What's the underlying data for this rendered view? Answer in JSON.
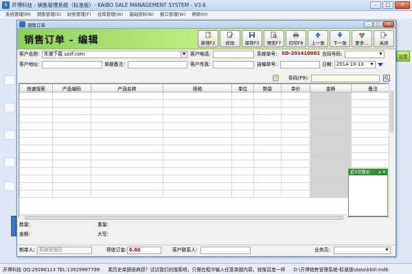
{
  "app": {
    "title": "开博科技 - 销售管理系统（标准版）- KAIBO SALE MANAGEMENT SYSTEM - V3.6",
    "menu": [
      "系统管理(M)",
      "销售管理(S)",
      "财务管理(F)",
      "仓库管理(W)",
      "基础资料(B)",
      "窗口管理(W)",
      "帮助(H)"
    ],
    "right_button": "设置"
  },
  "status_bar": {
    "company": "开博科技 QQ:29286113 TEL:13929987799",
    "hint": "素历史单据很麻烦？试试我们的搜索吧，只需在框中输入任意单据内容，就像百度一样",
    "path": "D:\\开博销售管理系统-标准版\\data\\kbill.mdb"
  },
  "window": {
    "title": "销售订单",
    "page_title": "销售订单 - 编辑"
  },
  "toolbar": [
    {
      "label": "新增F2",
      "icon": "new-icon"
    },
    {
      "label": "修改",
      "icon": "edit-icon"
    },
    {
      "label": "保存F3",
      "icon": "save-icon"
    },
    {
      "label": "预览F7",
      "icon": "preview-icon"
    },
    {
      "label": "打印F8",
      "icon": "print-icon"
    },
    {
      "label": "上一张",
      "icon": "arrow-up-icon"
    },
    {
      "label": "下一张",
      "icon": "arrow-down-icon"
    },
    {
      "label": "更多…",
      "icon": "more-icon"
    },
    {
      "label": "关闭",
      "icon": "close-icon"
    }
  ],
  "form": {
    "customer_name_label": "客户名称:",
    "customer_name_value": "东坡下载 uzzf.com",
    "customer_phone_label": "客户电话:",
    "system_no_label": "系统单号:",
    "system_no_value": "SD-201410001",
    "contract_no_label": "合同号码:",
    "customer_address_label": "客户地址:",
    "note_label": "单据备注:",
    "customer_fax_label": "客户传真:",
    "custom_no_label": "自编单号:",
    "date_label": "日期:",
    "date_value": "2014-10-13",
    "barcode_label": "条码(F9):"
  },
  "grid": {
    "columns": [
      "快速搜索",
      "产品编码",
      "产品名称",
      "规格",
      "单位",
      "数量",
      "单价",
      "金额",
      "备注"
    ]
  },
  "panel": {
    "title": "近5次售价"
  },
  "footer": {
    "qty_label": "数量:",
    "weight_label": "重量:",
    "amount_label": "金额:",
    "capital_label": "大写:",
    "maker_label": "制单人:",
    "maker_value": "系统管理员",
    "deposit_label": "预收订金:",
    "deposit_value": "0.00",
    "contact_label": "客户联系人:",
    "salesman_label": "业务员:"
  }
}
